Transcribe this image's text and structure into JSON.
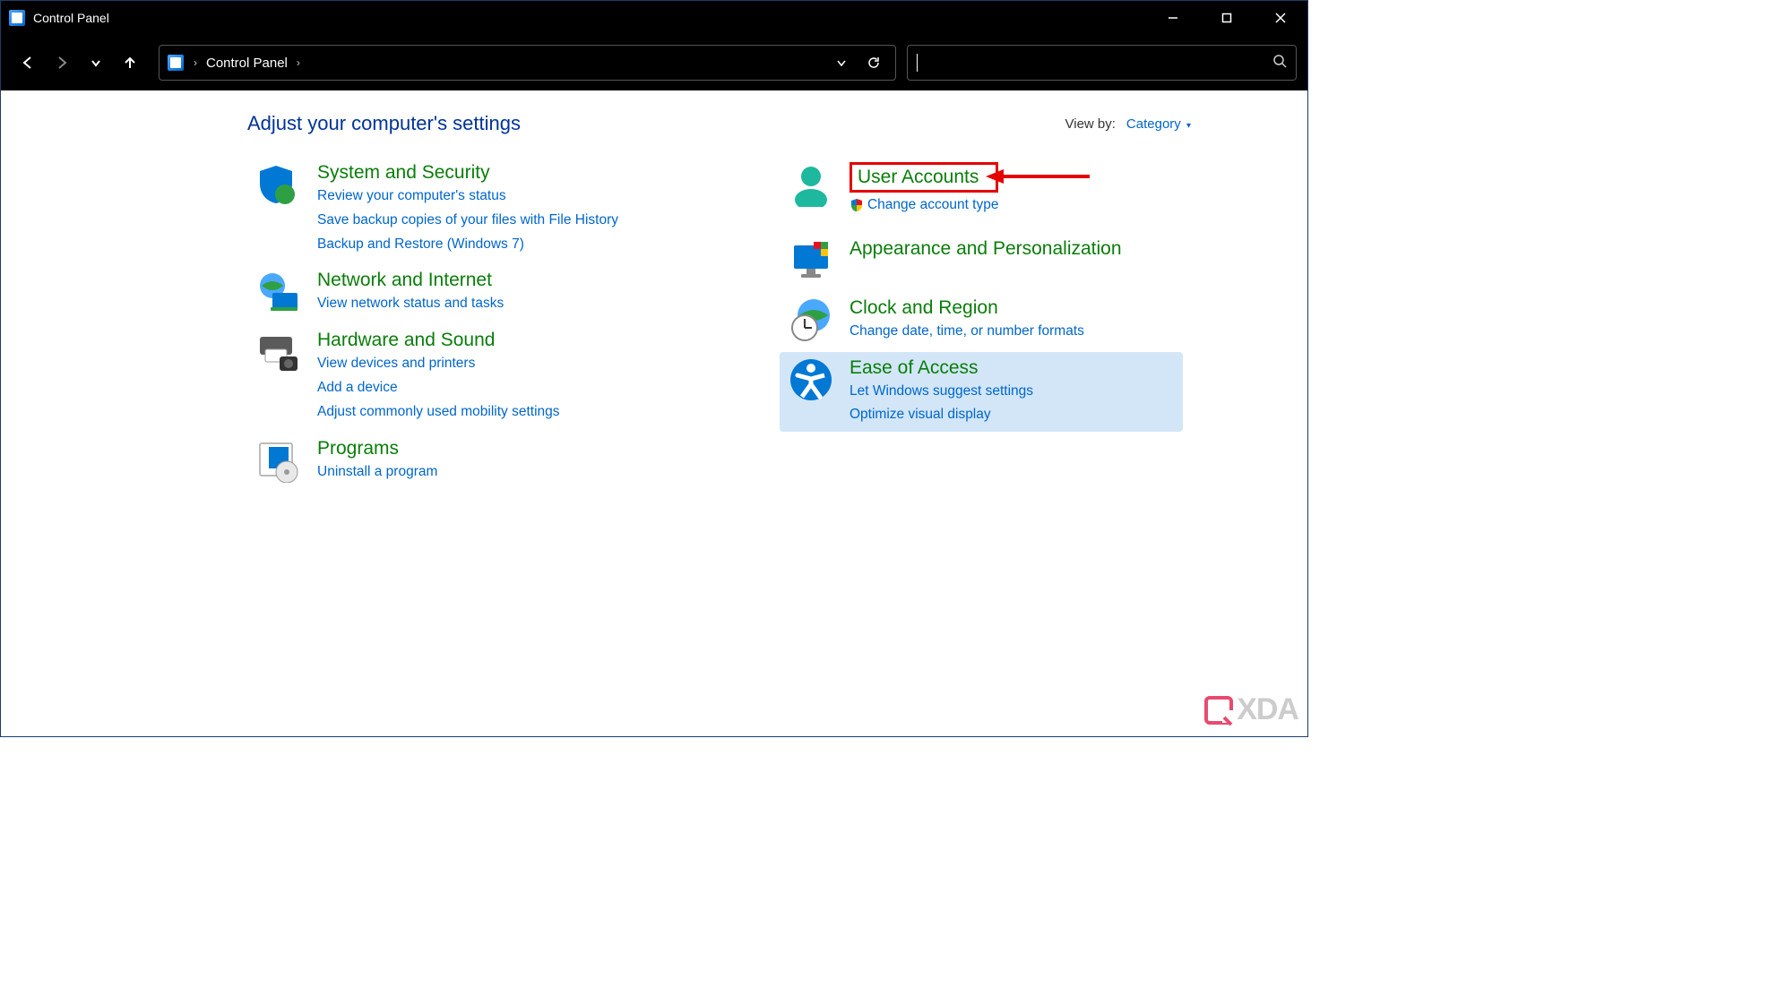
{
  "window": {
    "title": "Control Panel"
  },
  "address": {
    "location": "Control Panel"
  },
  "header": {
    "title": "Adjust your computer's settings",
    "viewby_label": "View by:",
    "viewby_value": "Category"
  },
  "categories": {
    "left": [
      {
        "title": "System and Security",
        "links": [
          "Review your computer's status",
          "Save backup copies of your files with File History",
          "Backup and Restore (Windows 7)"
        ]
      },
      {
        "title": "Network and Internet",
        "links": [
          "View network status and tasks"
        ]
      },
      {
        "title": "Hardware and Sound",
        "links": [
          "View devices and printers",
          "Add a device",
          "Adjust commonly used mobility settings"
        ]
      },
      {
        "title": "Programs",
        "links": [
          "Uninstall a program"
        ]
      }
    ],
    "right": [
      {
        "title": "User Accounts",
        "links": [
          "Change account type"
        ],
        "shield": true,
        "boxed": true
      },
      {
        "title": "Appearance and Personalization",
        "links": []
      },
      {
        "title": "Clock and Region",
        "links": [
          "Change date, time, or number formats"
        ]
      },
      {
        "title": "Ease of Access",
        "links": [
          "Let Windows suggest settings",
          "Optimize visual display"
        ],
        "highlighted": true
      }
    ]
  },
  "watermark": "XDA"
}
